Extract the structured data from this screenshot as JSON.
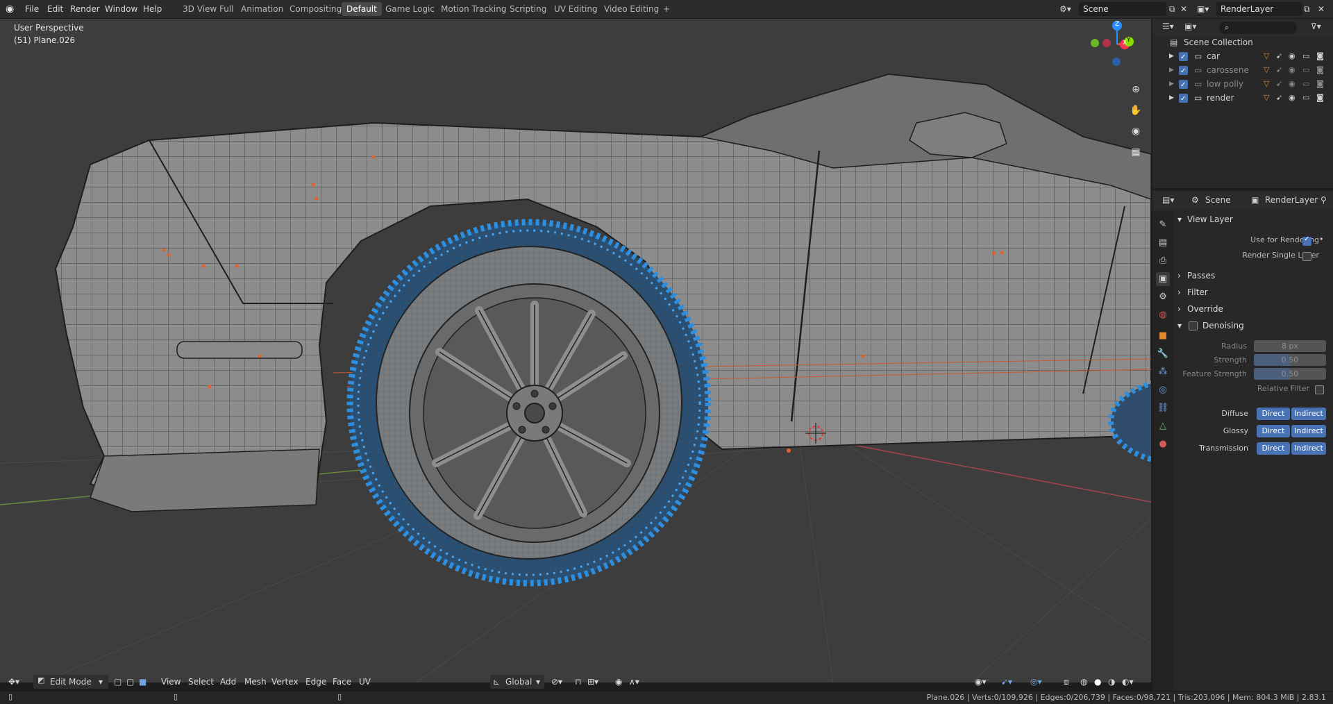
{
  "topbar": {
    "menus": [
      "File",
      "Edit",
      "Render",
      "Window",
      "Help"
    ],
    "workspaces": [
      "3D View Full",
      "Animation",
      "Compositing",
      "Default",
      "Game Logic",
      "Motion Tracking",
      "Scripting",
      "UV Editing",
      "Video Editing"
    ],
    "active_workspace": "Default",
    "add_tab": "+",
    "scene_name": "Scene",
    "view_layer_name": "RenderLayer"
  },
  "viewport": {
    "perspective": "User Perspective",
    "object_info": "(51) Plane.026",
    "gizmo_axes": [
      "Z",
      "X",
      "Y"
    ],
    "axis_colors": {
      "x": "#ff3352",
      "y": "#8bdc00",
      "z": "#2890ff"
    },
    "selection_color": "#2e8fe0",
    "mesh_vertex_color": "#e5602a"
  },
  "vp_header": {
    "mode": "Edit Mode",
    "menus": [
      "View",
      "Select",
      "Add",
      "Mesh",
      "Vertex",
      "Edge",
      "Face",
      "UV"
    ],
    "transform_orientation": "Global"
  },
  "statusbar": {
    "stats": "Plane.026 | Verts:0/109,926 | Edges:0/206,739 | Faces:0/98,721 | Tris:203,096 | Mem: 804.3 MiB | 2.83.1"
  },
  "outliner": {
    "root": "Scene Collection",
    "collections": [
      {
        "name": "car",
        "dim": false
      },
      {
        "name": "carossene",
        "dim": true
      },
      {
        "name": "low polly",
        "dim": true
      },
      {
        "name": "render",
        "dim": false
      }
    ],
    "search_placeholder": ""
  },
  "properties": {
    "breadcrumb_scene": "Scene",
    "breadcrumb_layer": "RenderLayer",
    "view_layer_title": "View Layer",
    "use_for_rendering": "Use for Rendering",
    "use_for_rendering_checked": true,
    "render_single_layer": "Render Single Layer",
    "render_single_layer_checked": false,
    "panels": [
      "Passes",
      "Filter",
      "Override"
    ],
    "denoising": {
      "title": "Denoising",
      "enabled": false,
      "radius_label": "Radius",
      "radius_value": "8 px",
      "strength_label": "Strength",
      "strength_value": "0.50",
      "strength_level": 0.5,
      "feature_strength_label": "Feature Strength",
      "feature_strength_value": "0.50",
      "feature_strength_level": 0.5,
      "relative_filter_label": "Relative Filter"
    },
    "passes_rows": [
      {
        "label": "Diffuse",
        "a": "Direct",
        "b": "Indirect"
      },
      {
        "label": "Glossy",
        "a": "Direct",
        "b": "Indirect"
      },
      {
        "label": "Transmission",
        "a": "Direct",
        "b": "Indirect"
      }
    ]
  }
}
